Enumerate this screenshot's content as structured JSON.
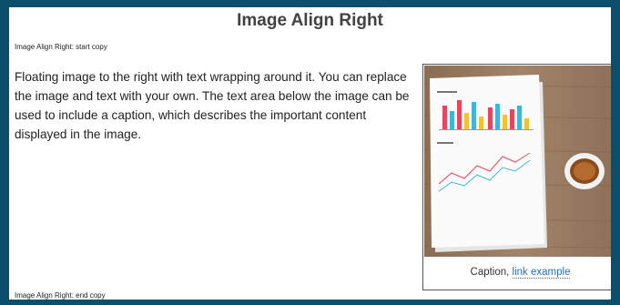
{
  "page": {
    "title": "Image Align Right",
    "start_marker": "Image Align Right: start copy",
    "end_marker": "Image Align Right: end copy",
    "paragraph": "Floating image to the right with text wrapping around it. You can replace the image and text with your own. The text area below the image can be used to include a caption, which describes the important content displayed in the image."
  },
  "figure": {
    "caption_prefix": "Caption, ",
    "caption_link": "link example"
  },
  "colors": {
    "frame": "#0b4f6c",
    "link": "#2a6fb0"
  }
}
